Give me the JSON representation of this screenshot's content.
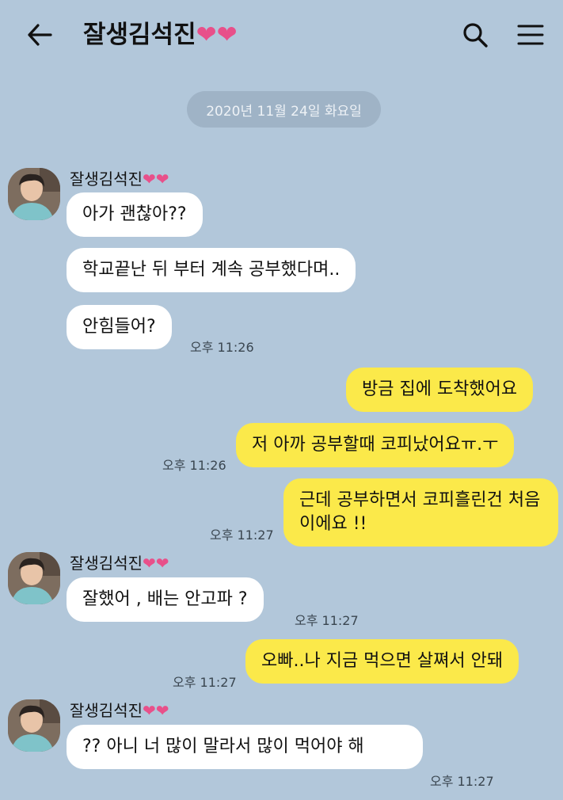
{
  "header": {
    "title": "잘생김석진",
    "title_hearts": "❤❤"
  },
  "date_divider": "2020년 11월 24일 화요일",
  "sender": {
    "name": "잘생김석진",
    "hearts": "❤❤"
  },
  "messages": [
    {
      "text": "아가 괜찮아??"
    },
    {
      "text": "학교끝난 뒤 부터 계속 공부했다며.."
    },
    {
      "text": "안힘들어?",
      "time": "오후 11:26"
    },
    {
      "text": "방금 집에 도착했어요"
    },
    {
      "text": "저 아까 공부할때 코피났어요ㅠ.ㅜ",
      "time": "오후 11:26"
    },
    {
      "text": "근데 공부하면서 코피흘린건 처음이에요 !!",
      "time": "오후 11:27"
    },
    {
      "text": "잘했어 , 배는 안고파 ?",
      "time": "오후 11:27"
    },
    {
      "text": "오빠..나 지금 먹으면 살쪄서 안돼",
      "time": "오후 11:27"
    },
    {
      "text": "?? 아니 너 많이 말라서 많이 먹어야 해",
      "time": "오후 11:27"
    }
  ]
}
